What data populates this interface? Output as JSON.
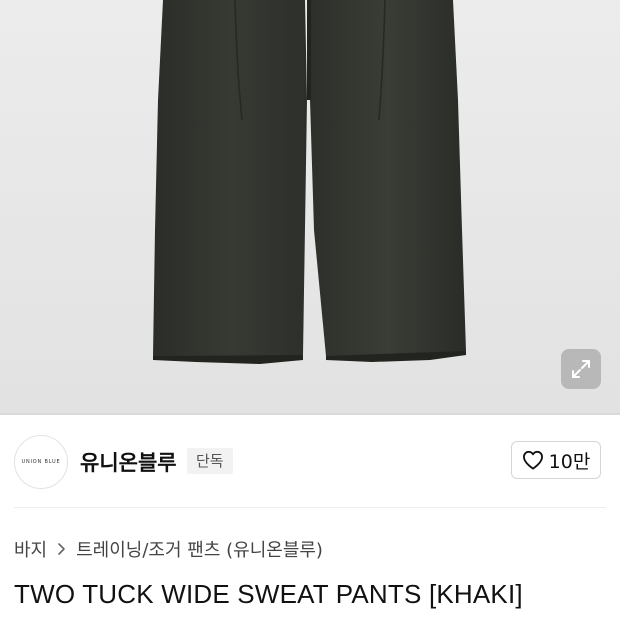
{
  "product_image": {
    "alt": "TWO TUCK WIDE SWEAT PANTS [KHAKI]",
    "background_color": "#e8e8e8",
    "garment_color": "#32352f",
    "zoom_icon": "expand-arrows-icon"
  },
  "brand": {
    "logo_text": "UNION BLUE",
    "name": "유니온블루",
    "badge": "단독"
  },
  "like": {
    "icon": "heart-outline-icon",
    "count": "10만"
  },
  "breadcrumb": {
    "category": "바지",
    "separator_icon": "chevron-right-icon",
    "subcategory": "트레이닝/조거 팬츠 (유니온블루)"
  },
  "product": {
    "title": "TWO TUCK WIDE SWEAT PANTS [KHAKI]"
  }
}
